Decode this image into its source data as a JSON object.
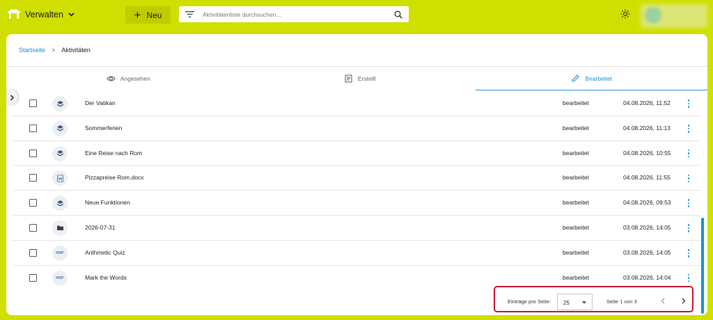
{
  "header": {
    "brand_label": "Verwalten",
    "brand_icon": "table-icon",
    "new_button_label": "Neu",
    "search_placeholder": "Aktivitätenliste durchsuchen...",
    "theme_icon": "sun-icon",
    "accent_color": "#cfe000"
  },
  "breadcrumb": {
    "home": "Startseite",
    "separator": ">",
    "current": "Aktivitäten"
  },
  "tabs": [
    {
      "label": "Angesehen",
      "icon": "eye-icon",
      "active": false
    },
    {
      "label": "Erstellt",
      "icon": "document-icon",
      "active": false
    },
    {
      "label": "Bearbeitet",
      "icon": "pencil-icon",
      "active": true
    }
  ],
  "rows": [
    {
      "type": "content-icon",
      "name": "Der Vatikan",
      "status": "bearbeitet",
      "date": "04.08.2026, 11:52"
    },
    {
      "type": "content-icon",
      "name": "Sommerferien",
      "status": "bearbeitet",
      "date": "04.08.2026, 11:13"
    },
    {
      "type": "content-icon",
      "name": "Eine Reise nach Rom",
      "status": "bearbeitet",
      "date": "04.08.2026, 10:55"
    },
    {
      "type": "word-icon",
      "name": "Pizzapreise Rom.docx",
      "status": "bearbeitet",
      "date": "04.08.2026, 11:55"
    },
    {
      "type": "content-icon",
      "name": "Neue Funktionen",
      "status": "bearbeitet",
      "date": "04.08.2026, 09:53"
    },
    {
      "type": "folder-icon",
      "name": "2026-07-31",
      "status": "bearbeitet",
      "date": "03.08.2026, 14:05"
    },
    {
      "type": "h5p-icon",
      "name": "Arithmetic Quiz",
      "status": "bearbeitet",
      "date": "03.08.2026, 14:05"
    },
    {
      "type": "h5p-icon",
      "name": "Mark the Words",
      "status": "bearbeitet",
      "date": "03.08.2026, 14:04"
    }
  ],
  "h5p_badge": "H5P",
  "pagination": {
    "per_page_label": "Einträge pro Seite:",
    "per_page_value": "25",
    "page_info": "Seite 1 von 3"
  }
}
